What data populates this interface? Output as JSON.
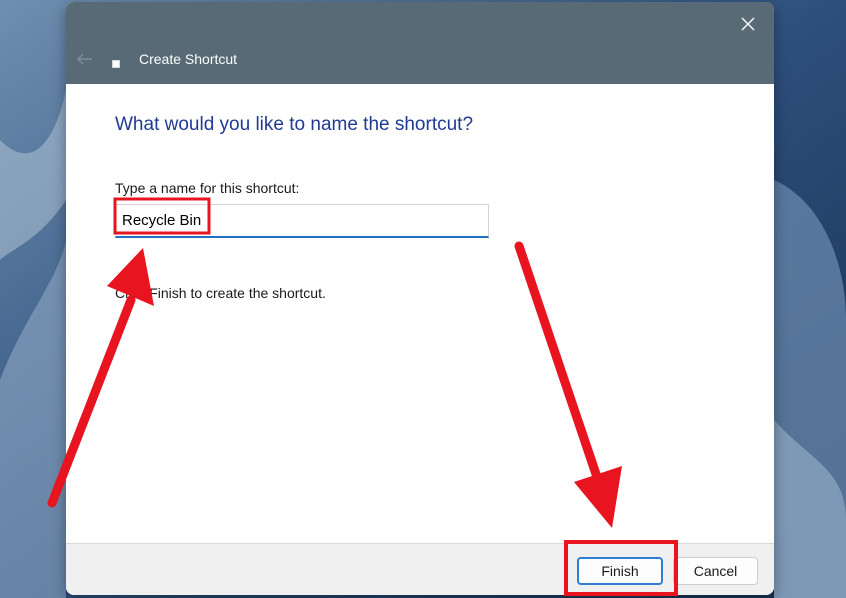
{
  "dialog": {
    "title": "Create Shortcut",
    "heading": "What would you like to name the shortcut?",
    "field_label": "Type a name for this shortcut:",
    "input_value": "Recycle Bin",
    "hint": "Click Finish to create the shortcut.",
    "buttons": {
      "finish": "Finish",
      "cancel": "Cancel"
    },
    "icons": {
      "close": "close-icon",
      "back": "back-arrow-icon",
      "title": "shortcut-icon"
    }
  },
  "colors": {
    "titlebar": "#576a76",
    "heading": "#1f3a93",
    "annotation": "#e8141f",
    "input_focus": "#1f6fc5"
  }
}
